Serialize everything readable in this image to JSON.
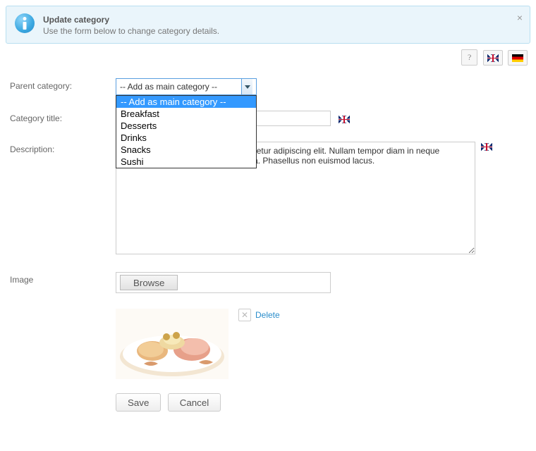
{
  "infoBox": {
    "title": "Update category",
    "subtitle": "Use the form below to change category details."
  },
  "langBar": {
    "help": "?"
  },
  "labels": {
    "parentCategory": "Parent category:",
    "categoryTitle": "Category title:",
    "description": "Description:",
    "image": "Image"
  },
  "parentCategory": {
    "selected": "-- Add as main category --",
    "options": [
      "-- Add as main category --",
      "Breakfast",
      "Desserts",
      "Drinks",
      "Snacks",
      "Sushi"
    ]
  },
  "titleField": {
    "value": ""
  },
  "description": {
    "value": "Lorem ipsum dolor sit amet, consectetur adipiscing elit. Nullam tempor diam in neque sollicitudin, ac imperdiet odio fringilla. Phasellus non euismod lacus."
  },
  "fileField": {
    "browseLabel": "Browse"
  },
  "imageItem": {
    "deleteLabel": "Delete"
  },
  "buttons": {
    "save": "Save",
    "cancel": "Cancel"
  }
}
